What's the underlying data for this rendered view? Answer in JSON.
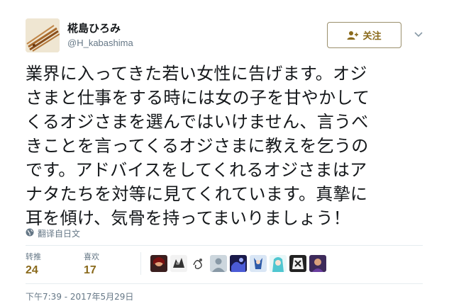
{
  "user": {
    "display_name": "椛島ひろみ",
    "handle": "@H_kabashima",
    "avatar_icon": "calligraphy-brush-avatar"
  },
  "follow_button": {
    "label": "关注",
    "icon": "follow-person-plus-icon"
  },
  "menu_icon": "chevron-down-icon",
  "tweet": {
    "lines": [
      "業界に入ってきた若い女性に告げます。オジ",
      "さまと仕事をする時には女の子を甘やかして",
      "くるオジさまを選んではいけません、言うべ",
      "きことを言ってくるオジさまに教えを乞うの",
      "です。アドバイスをしてくれるオジさまはア",
      "ナタたちを対等に見てくれています。真摯に",
      "耳を傾け、気骨を持ってまいりましょう！"
    ]
  },
  "translate": {
    "label": "翻译自日文",
    "icon": "globe-icon"
  },
  "stats": {
    "retweets": {
      "label": "转推",
      "value": "24"
    },
    "likes": {
      "label": "喜欢",
      "value": "17"
    }
  },
  "likers_avatar_count": 10,
  "timestamp": "下午7:39 - 2017年5月29日",
  "colors": {
    "accent": "#8a6a1c",
    "muted": "#657786",
    "text": "#14171a",
    "divider": "#e6ecf0"
  }
}
